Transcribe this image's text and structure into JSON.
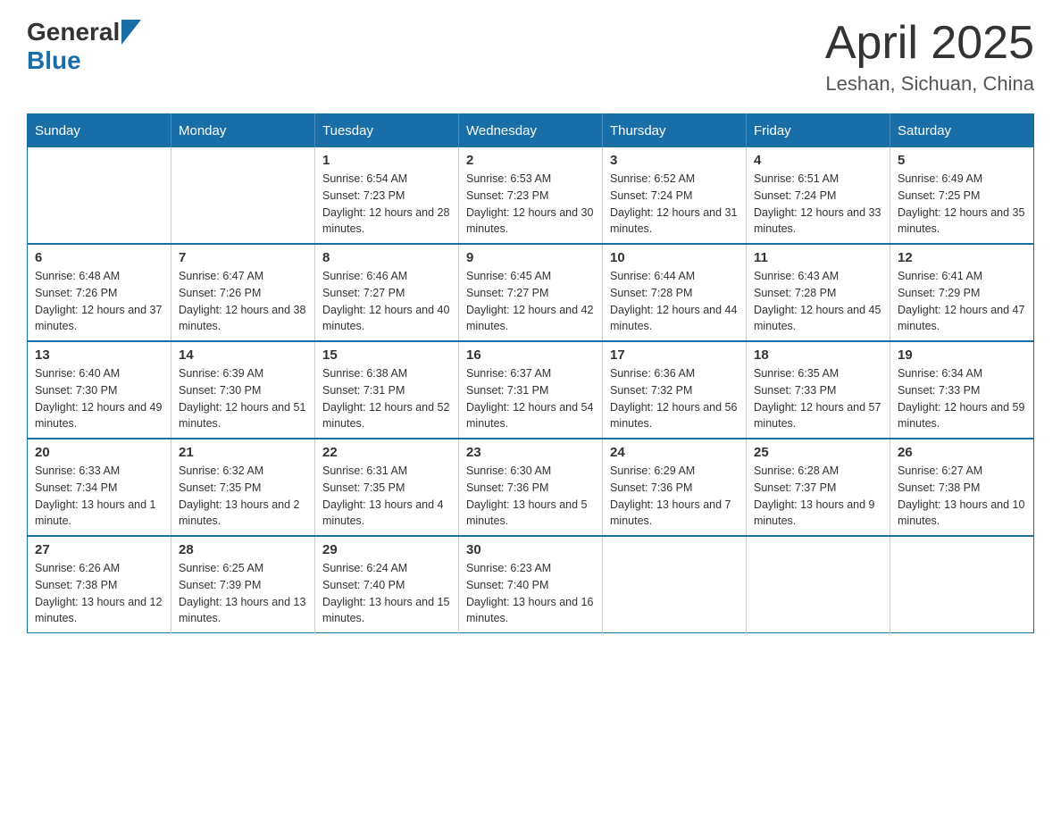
{
  "logo": {
    "general": "General",
    "blue": "Blue"
  },
  "title": {
    "month_year": "April 2025",
    "location": "Leshan, Sichuan, China"
  },
  "headers": [
    "Sunday",
    "Monday",
    "Tuesday",
    "Wednesday",
    "Thursday",
    "Friday",
    "Saturday"
  ],
  "weeks": [
    [
      {
        "day": "",
        "info": ""
      },
      {
        "day": "",
        "info": ""
      },
      {
        "day": "1",
        "info": "Sunrise: 6:54 AM\nSunset: 7:23 PM\nDaylight: 12 hours and 28 minutes."
      },
      {
        "day": "2",
        "info": "Sunrise: 6:53 AM\nSunset: 7:23 PM\nDaylight: 12 hours and 30 minutes."
      },
      {
        "day": "3",
        "info": "Sunrise: 6:52 AM\nSunset: 7:24 PM\nDaylight: 12 hours and 31 minutes."
      },
      {
        "day": "4",
        "info": "Sunrise: 6:51 AM\nSunset: 7:24 PM\nDaylight: 12 hours and 33 minutes."
      },
      {
        "day": "5",
        "info": "Sunrise: 6:49 AM\nSunset: 7:25 PM\nDaylight: 12 hours and 35 minutes."
      }
    ],
    [
      {
        "day": "6",
        "info": "Sunrise: 6:48 AM\nSunset: 7:26 PM\nDaylight: 12 hours and 37 minutes."
      },
      {
        "day": "7",
        "info": "Sunrise: 6:47 AM\nSunset: 7:26 PM\nDaylight: 12 hours and 38 minutes."
      },
      {
        "day": "8",
        "info": "Sunrise: 6:46 AM\nSunset: 7:27 PM\nDaylight: 12 hours and 40 minutes."
      },
      {
        "day": "9",
        "info": "Sunrise: 6:45 AM\nSunset: 7:27 PM\nDaylight: 12 hours and 42 minutes."
      },
      {
        "day": "10",
        "info": "Sunrise: 6:44 AM\nSunset: 7:28 PM\nDaylight: 12 hours and 44 minutes."
      },
      {
        "day": "11",
        "info": "Sunrise: 6:43 AM\nSunset: 7:28 PM\nDaylight: 12 hours and 45 minutes."
      },
      {
        "day": "12",
        "info": "Sunrise: 6:41 AM\nSunset: 7:29 PM\nDaylight: 12 hours and 47 minutes."
      }
    ],
    [
      {
        "day": "13",
        "info": "Sunrise: 6:40 AM\nSunset: 7:30 PM\nDaylight: 12 hours and 49 minutes."
      },
      {
        "day": "14",
        "info": "Sunrise: 6:39 AM\nSunset: 7:30 PM\nDaylight: 12 hours and 51 minutes."
      },
      {
        "day": "15",
        "info": "Sunrise: 6:38 AM\nSunset: 7:31 PM\nDaylight: 12 hours and 52 minutes."
      },
      {
        "day": "16",
        "info": "Sunrise: 6:37 AM\nSunset: 7:31 PM\nDaylight: 12 hours and 54 minutes."
      },
      {
        "day": "17",
        "info": "Sunrise: 6:36 AM\nSunset: 7:32 PM\nDaylight: 12 hours and 56 minutes."
      },
      {
        "day": "18",
        "info": "Sunrise: 6:35 AM\nSunset: 7:33 PM\nDaylight: 12 hours and 57 minutes."
      },
      {
        "day": "19",
        "info": "Sunrise: 6:34 AM\nSunset: 7:33 PM\nDaylight: 12 hours and 59 minutes."
      }
    ],
    [
      {
        "day": "20",
        "info": "Sunrise: 6:33 AM\nSunset: 7:34 PM\nDaylight: 13 hours and 1 minute."
      },
      {
        "day": "21",
        "info": "Sunrise: 6:32 AM\nSunset: 7:35 PM\nDaylight: 13 hours and 2 minutes."
      },
      {
        "day": "22",
        "info": "Sunrise: 6:31 AM\nSunset: 7:35 PM\nDaylight: 13 hours and 4 minutes."
      },
      {
        "day": "23",
        "info": "Sunrise: 6:30 AM\nSunset: 7:36 PM\nDaylight: 13 hours and 5 minutes."
      },
      {
        "day": "24",
        "info": "Sunrise: 6:29 AM\nSunset: 7:36 PM\nDaylight: 13 hours and 7 minutes."
      },
      {
        "day": "25",
        "info": "Sunrise: 6:28 AM\nSunset: 7:37 PM\nDaylight: 13 hours and 9 minutes."
      },
      {
        "day": "26",
        "info": "Sunrise: 6:27 AM\nSunset: 7:38 PM\nDaylight: 13 hours and 10 minutes."
      }
    ],
    [
      {
        "day": "27",
        "info": "Sunrise: 6:26 AM\nSunset: 7:38 PM\nDaylight: 13 hours and 12 minutes."
      },
      {
        "day": "28",
        "info": "Sunrise: 6:25 AM\nSunset: 7:39 PM\nDaylight: 13 hours and 13 minutes."
      },
      {
        "day": "29",
        "info": "Sunrise: 6:24 AM\nSunset: 7:40 PM\nDaylight: 13 hours and 15 minutes."
      },
      {
        "day": "30",
        "info": "Sunrise: 6:23 AM\nSunset: 7:40 PM\nDaylight: 13 hours and 16 minutes."
      },
      {
        "day": "",
        "info": ""
      },
      {
        "day": "",
        "info": ""
      },
      {
        "day": "",
        "info": ""
      }
    ]
  ]
}
